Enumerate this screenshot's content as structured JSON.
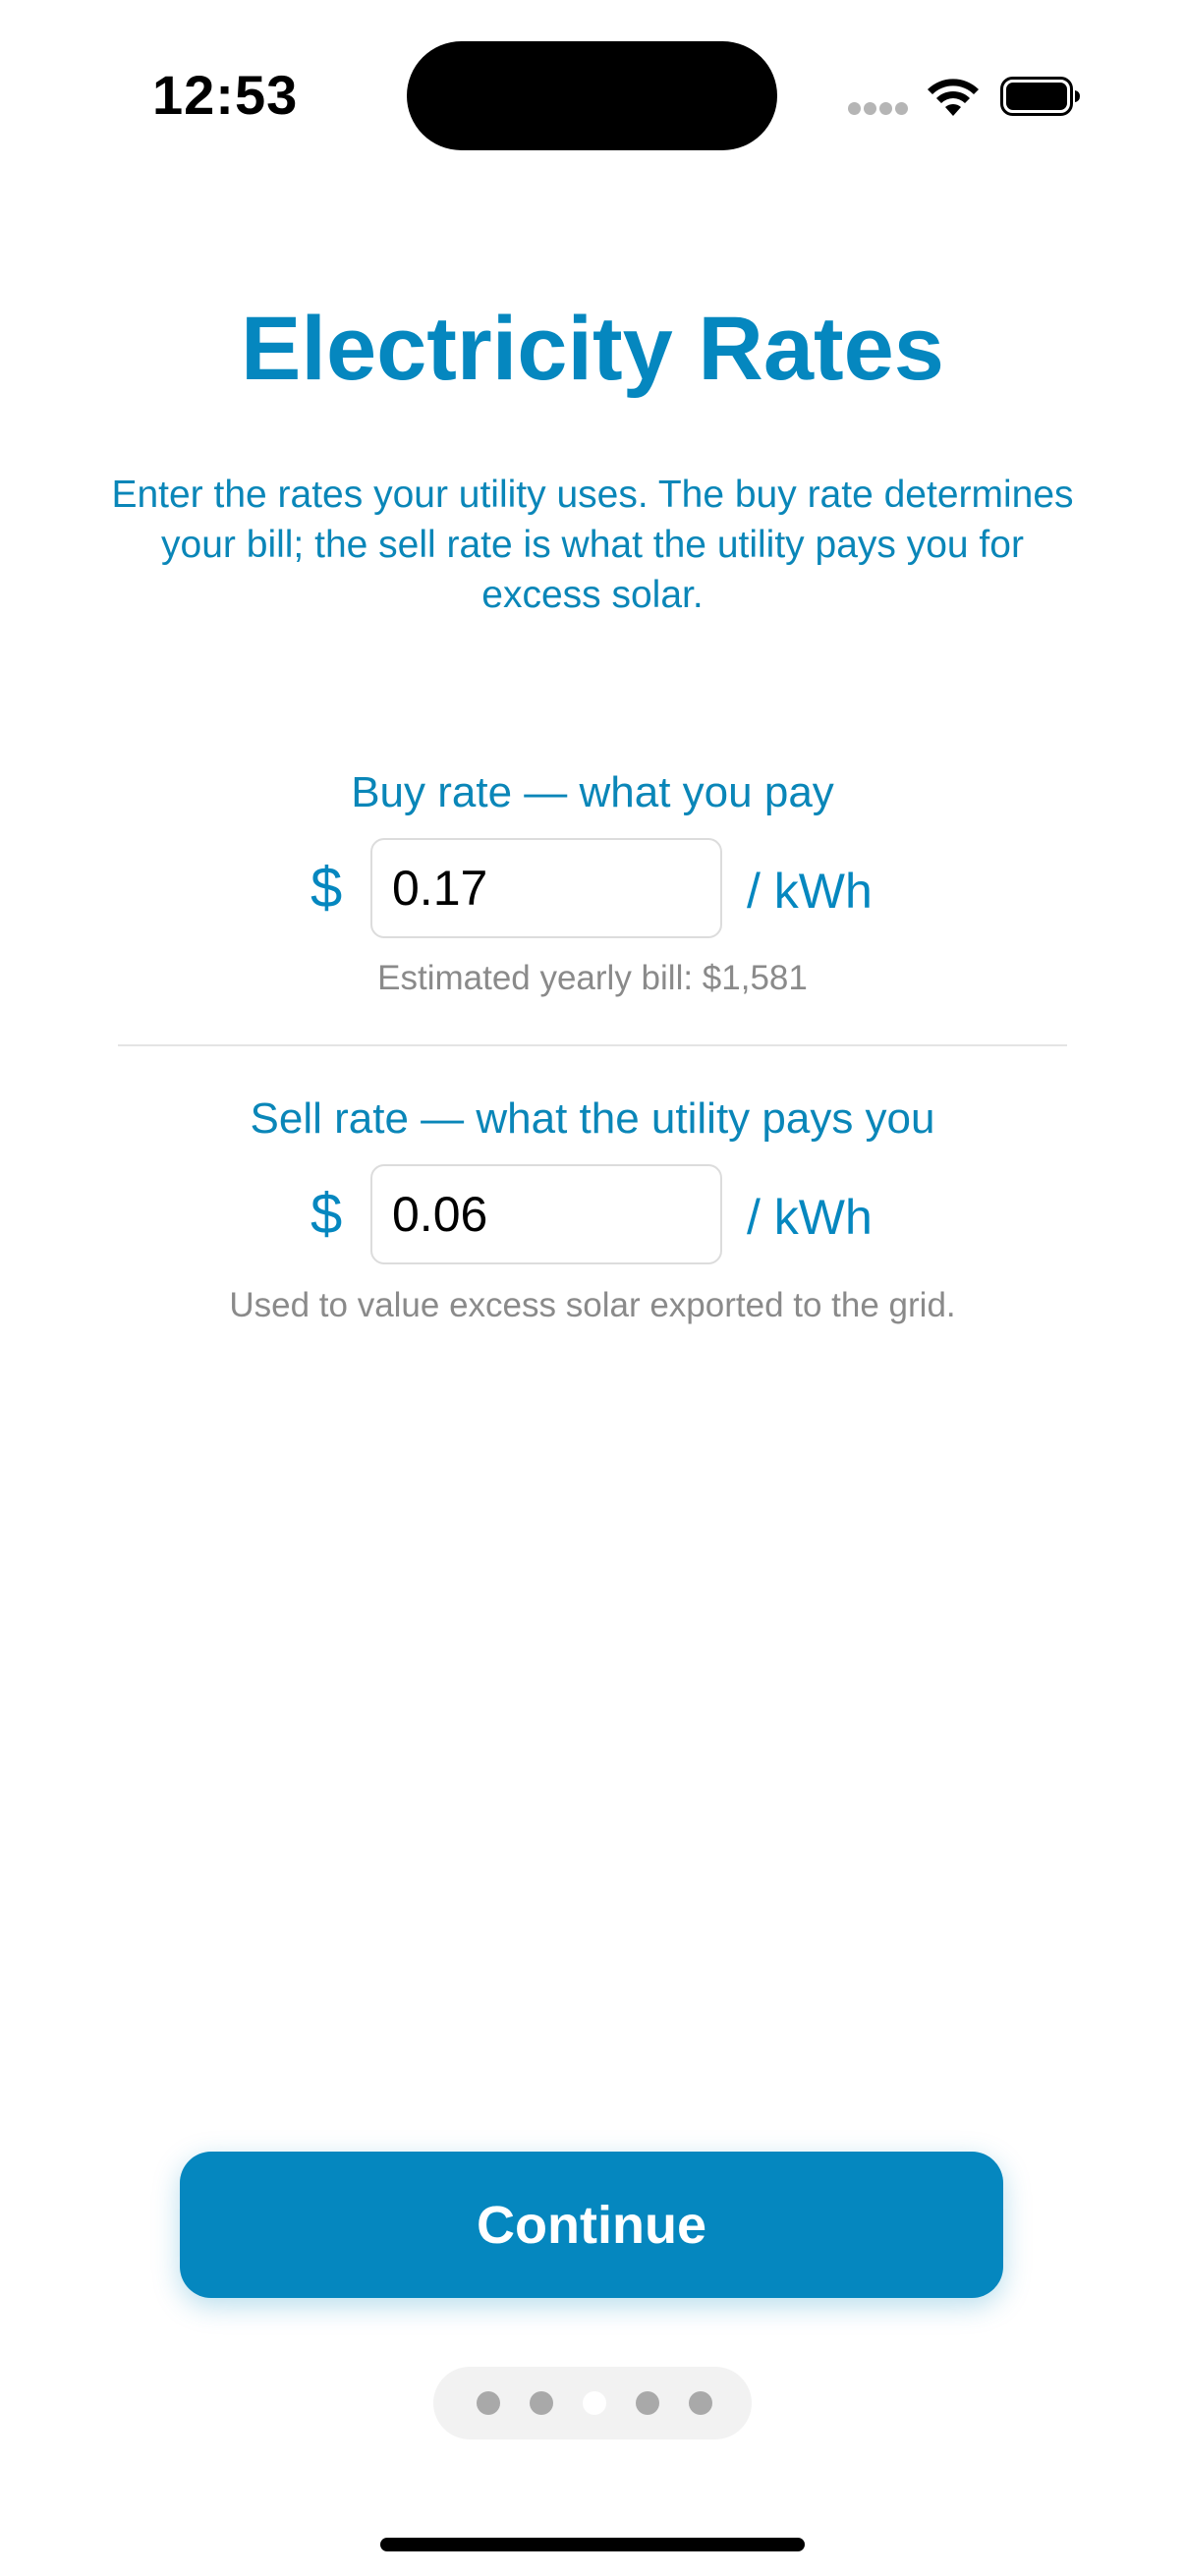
{
  "status_bar": {
    "time": "12:53"
  },
  "header": {
    "title": "Electricity Rates",
    "description": "Enter the rates your utility uses. The buy rate determines your bill; the sell rate is what the utility pays you for excess solar."
  },
  "buy_rate": {
    "label": "Buy rate — what you pay",
    "currency": "$",
    "value": "0.17",
    "unit": "/ kWh",
    "note": "Estimated yearly bill: $1,581"
  },
  "sell_rate": {
    "label": "Sell rate — what the utility pays you",
    "currency": "$",
    "value": "0.06",
    "unit": "/ kWh",
    "note": "Used to value excess solar exported to the grid."
  },
  "continue_button": {
    "label": "Continue"
  },
  "page_indicator": {
    "total_pages": 5,
    "current_page": 3
  },
  "colors": {
    "accent": "#0587bf",
    "secondary_text": "#8a8a8a",
    "divider": "#e4e4e4"
  }
}
